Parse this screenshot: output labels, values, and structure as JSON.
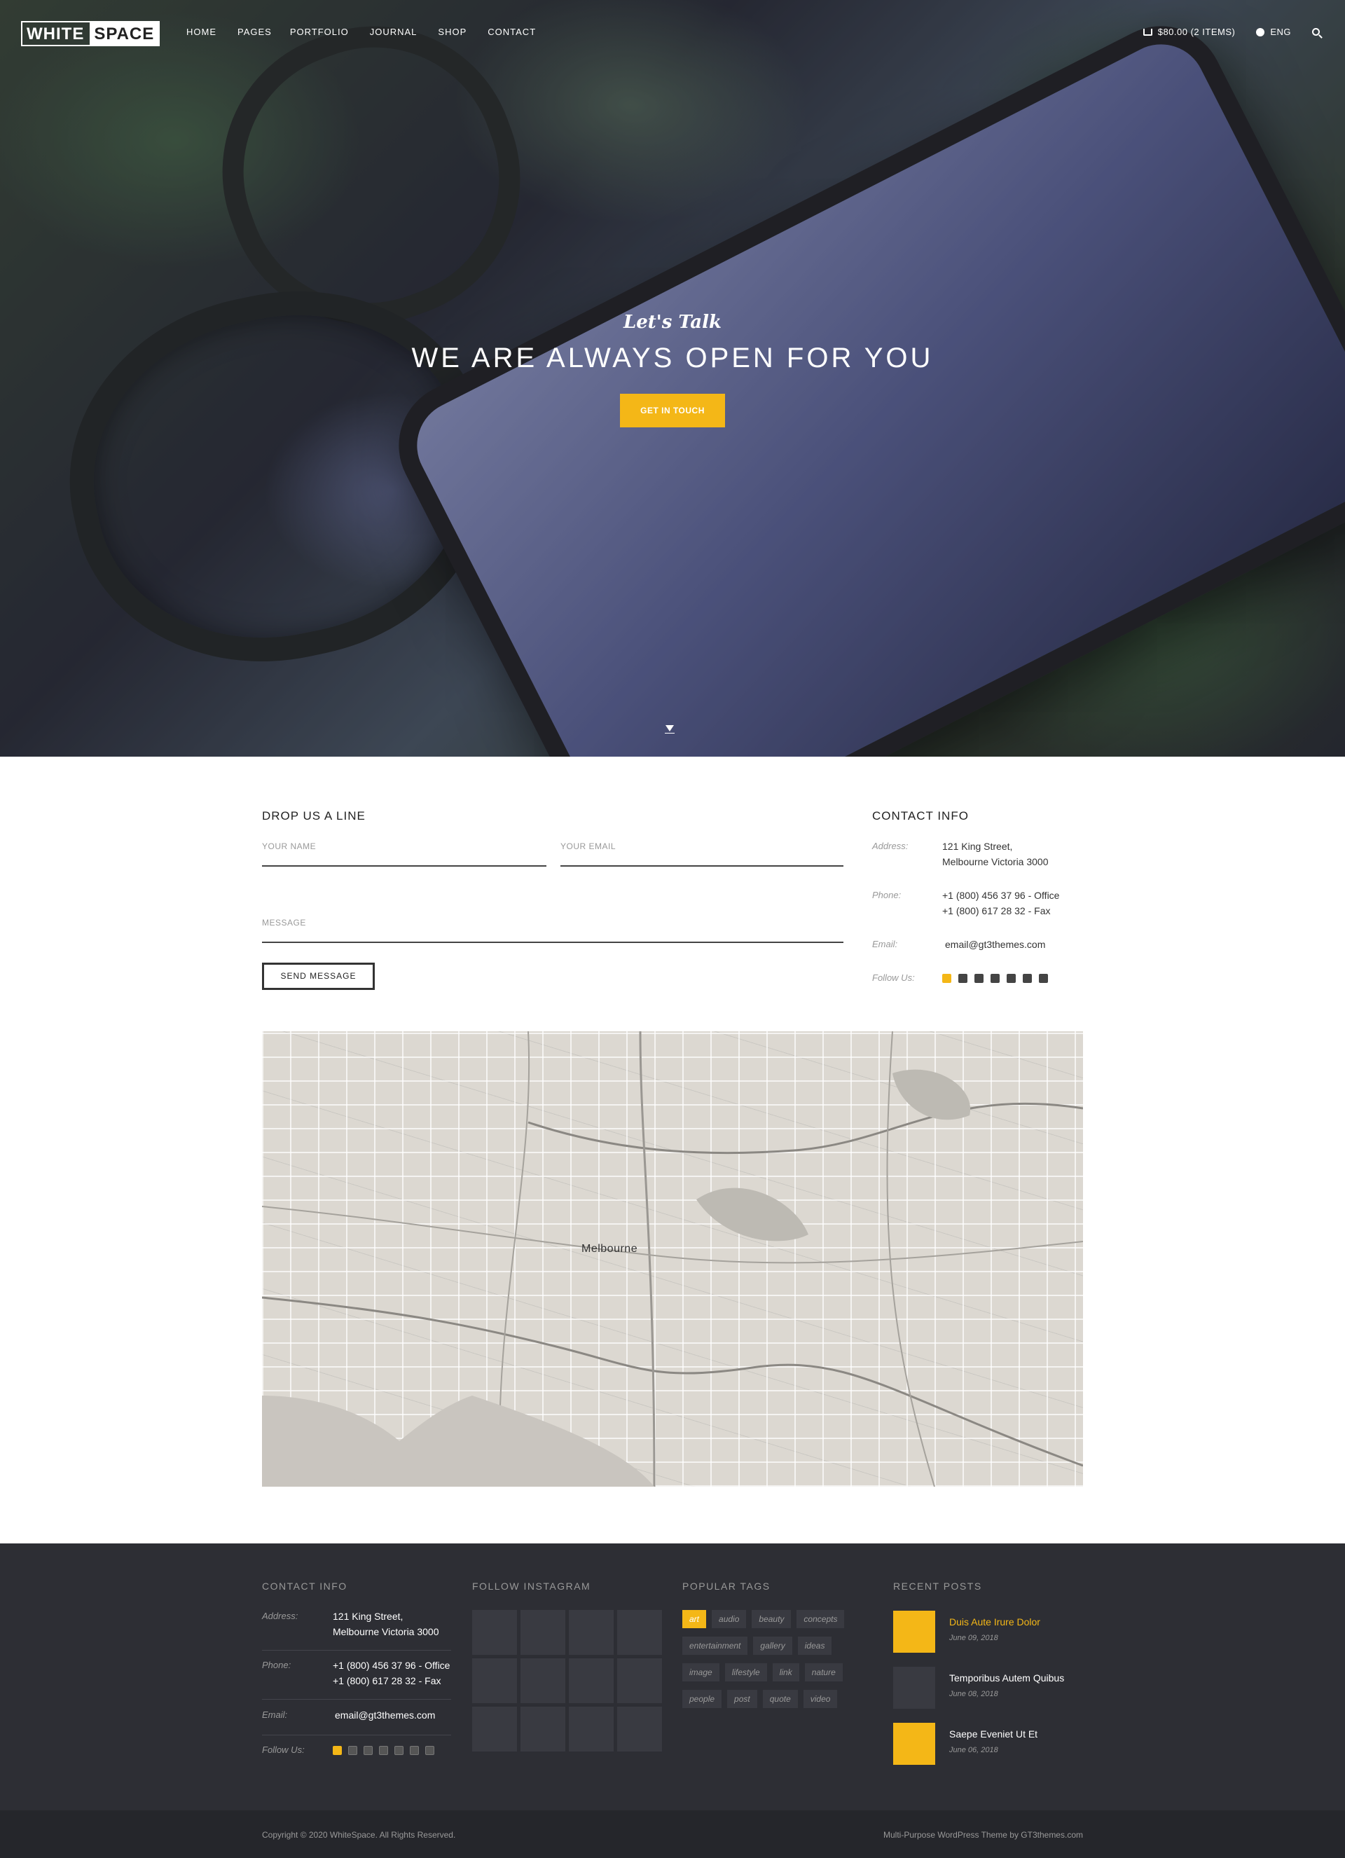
{
  "header": {
    "logo_part1": "WHITE",
    "logo_part2": "SPACE",
    "menu": [
      "HOME",
      "PAGES",
      "PORTFOLIO",
      "JOURNAL",
      "SHOP",
      "CONTACT"
    ],
    "cart_label": "$80.00 (2 ITEMS)",
    "language": "ENG"
  },
  "hero": {
    "script": "Let's Talk",
    "title": "WE ARE ALWAYS OPEN FOR YOU",
    "button": "GET IN TOUCH"
  },
  "form": {
    "heading": "DROP US A LINE",
    "name_placeholder": "YOUR NAME",
    "email_placeholder": "YOUR EMAIL",
    "message_placeholder": "MESSAGE",
    "send_label": "SEND MESSAGE"
  },
  "contact_info": {
    "heading": "CONTACT INFO",
    "address_label": "Address:",
    "address_line1": "121 King Street,",
    "address_line2": "Melbourne Victoria 3000",
    "phone_label": "Phone:",
    "phone_office": "+1 (800) 456 37 96 - Office",
    "phone_fax": "+1 (800) 617 28 32 - Fax",
    "email_label": "Email:",
    "email": "email@gt3themes.com",
    "follow_label": "Follow Us:",
    "social_icons": [
      "facebook-icon",
      "pinterest-icon",
      "twitter-icon",
      "instagram-icon",
      "flickr-icon",
      "linkedin-icon",
      "camera-icon"
    ]
  },
  "map": {
    "city_label": "Melbourne"
  },
  "footer": {
    "contact_heading": "CONTACT INFO",
    "instagram_heading": "FOLLOW INSTAGRAM",
    "tags_heading": "POPULAR TAGS",
    "posts_heading": "RECENT POSTS",
    "tags": [
      "art",
      "audio",
      "beauty",
      "concepts",
      "entertainment",
      "gallery",
      "ideas",
      "image",
      "lifestyle",
      "link",
      "nature",
      "people",
      "post",
      "quote",
      "video"
    ],
    "active_tag": "art",
    "posts": [
      {
        "title": "Duis Aute Irure Dolor",
        "date": "June 09, 2018"
      },
      {
        "title": "Temporibus Autem Quibus",
        "date": "June 08, 2018"
      },
      {
        "title": "Saepe Eveniet Ut Et",
        "date": "June 06, 2018"
      }
    ],
    "copyright": "Copyright © 2020 WhiteSpace. All Rights Reserved.",
    "credit": "Multi-Purpose WordPress Theme by GT3themes.com"
  },
  "colors": {
    "accent": "#f4b717",
    "footer_bg": "#2d2e34",
    "bottom_bar": "#25262b"
  }
}
